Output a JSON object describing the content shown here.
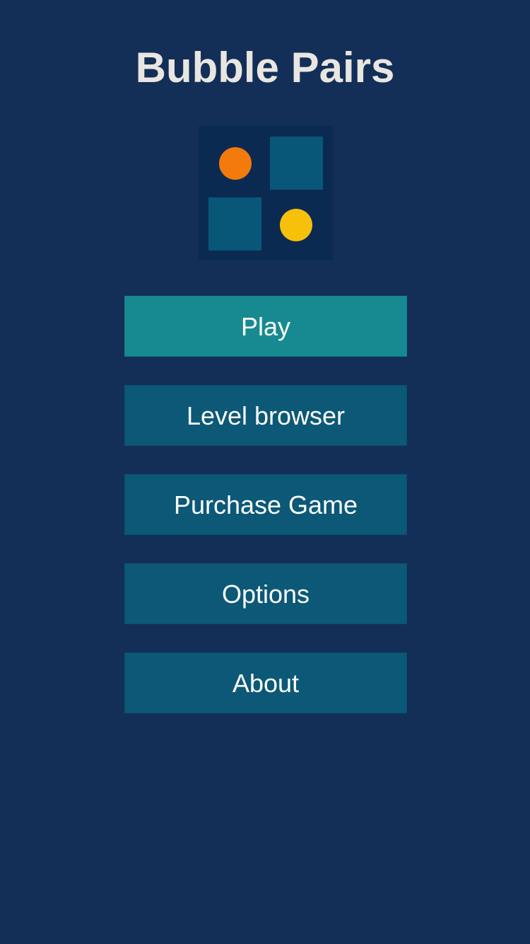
{
  "app": {
    "title": "Bubble Pairs"
  },
  "logo": {
    "icon": "bubble-pairs-logo-icon",
    "background": "#0b2a52",
    "tile_color": "#085778",
    "dot_colors": {
      "orange": "#f47a0b",
      "yellow": "#f7c10a"
    }
  },
  "menu": {
    "buttons": [
      {
        "id": "play",
        "label": "Play",
        "color": "#178a91",
        "active": true
      },
      {
        "id": "level-browser",
        "label": "Level browser",
        "color": "#0b5877",
        "active": false
      },
      {
        "id": "purchase-game",
        "label": "Purchase Game",
        "color": "#0b5877",
        "active": false
      },
      {
        "id": "options",
        "label": "Options",
        "color": "#0b5877",
        "active": false
      },
      {
        "id": "about",
        "label": "About",
        "color": "#0b5877",
        "active": false
      }
    ]
  },
  "colors": {
    "background": "#132f57",
    "title_text": "#e9e6e1",
    "button_text": "#ffffff"
  }
}
